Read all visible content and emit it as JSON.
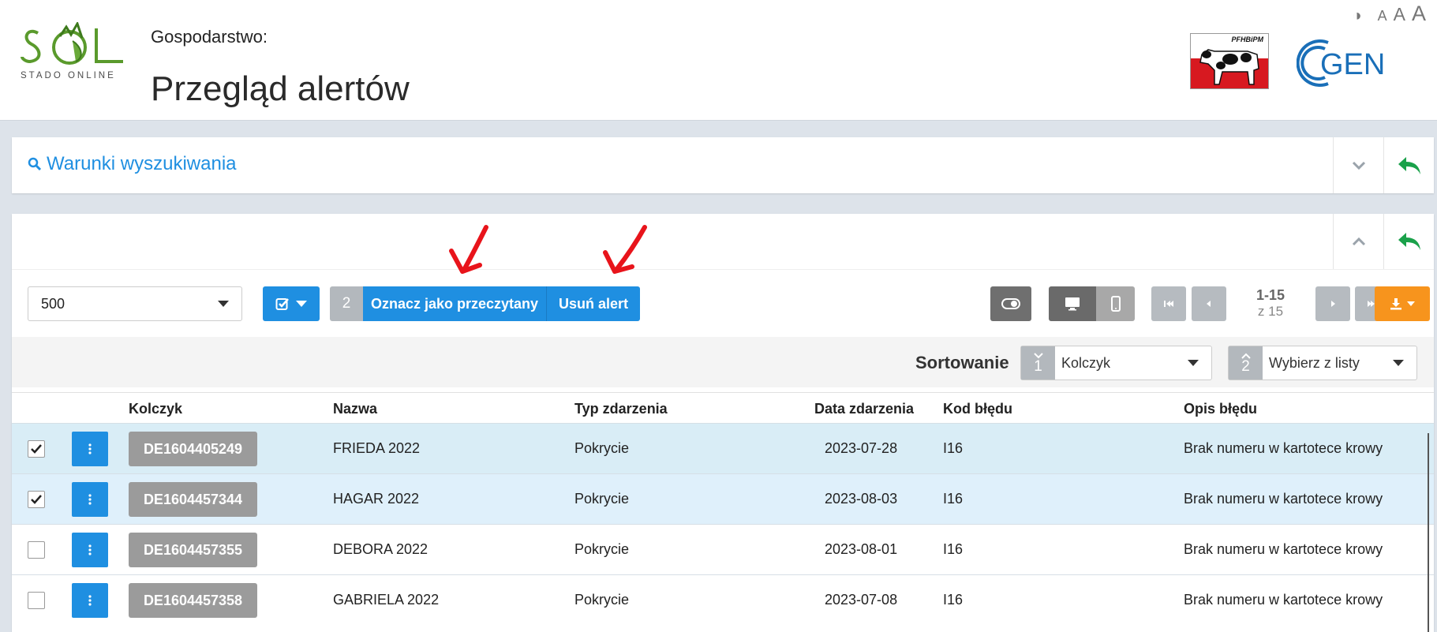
{
  "header": {
    "logo_text": "STADO ONLINE",
    "farm_label": "Gospodarstwo:",
    "title": "Przegląd alertów",
    "a11y": {
      "contrast": "◑",
      "a_small": "A",
      "a_medium": "A",
      "a_large": "A"
    },
    "pf_logo_text": "PFHBiPM",
    "cgen_text": "GEN"
  },
  "search_panel": {
    "title": "Warunki wyszukiwania"
  },
  "toolbar": {
    "page_size": "500",
    "selected_count": "2",
    "mark_read_label": "Oznacz jako przeczytany",
    "delete_alert_label": "Usuń alert",
    "pager_range": "1-15",
    "pager_total": "z 15"
  },
  "sorting": {
    "label": "Sortowanie",
    "first_num": "1",
    "first_value": "Kolczyk",
    "second_num": "2",
    "second_value": "Wybierz z listy"
  },
  "table": {
    "headers": {
      "tag": "Kolczyk",
      "name": "Nazwa",
      "event_type": "Typ zdarzenia",
      "event_date": "Data zdarzenia",
      "error_code": "Kod błędu",
      "error_desc": "Opis błędu"
    },
    "rows": [
      {
        "tag": "DE1604405249",
        "name": "FRIEDA 2022",
        "event_type": "Pokrycie",
        "event_date": "2023-07-28",
        "error_code": "I16",
        "error_desc": "Brak numeru w kartotece krowy",
        "checked": true
      },
      {
        "tag": "DE1604457344",
        "name": "HAGAR 2022",
        "event_type": "Pokrycie",
        "event_date": "2023-08-03",
        "error_code": "I16",
        "error_desc": "Brak numeru w kartotece krowy",
        "checked": true
      },
      {
        "tag": "DE1604457355",
        "name": "DEBORA 2022",
        "event_type": "Pokrycie",
        "event_date": "2023-08-01",
        "error_code": "I16",
        "error_desc": "Brak numeru w kartotece krowy",
        "checked": false
      },
      {
        "tag": "DE1604457358",
        "name": "GABRIELA 2022",
        "event_type": "Pokrycie",
        "event_date": "2023-07-08",
        "error_code": "I16",
        "error_desc": "Brak numeru w kartotece krowy",
        "checked": false
      }
    ]
  },
  "colors": {
    "primary_blue": "#1f8fe1",
    "green_action": "#1aa14a",
    "orange_export": "#f7941d",
    "annotation_red": "#e8141b",
    "selected_row": "#d9edf6"
  },
  "icons": [
    "search-icon",
    "chevron-down-icon",
    "chevron-up-icon",
    "reply-arrow-icon",
    "checkbox-icon",
    "toggle-icon",
    "desktop-icon",
    "mobile-icon",
    "first-page-icon",
    "prev-page-icon",
    "next-page-icon",
    "last-page-icon",
    "download-icon",
    "kebab-menu-icon",
    "checkmark-icon"
  ]
}
